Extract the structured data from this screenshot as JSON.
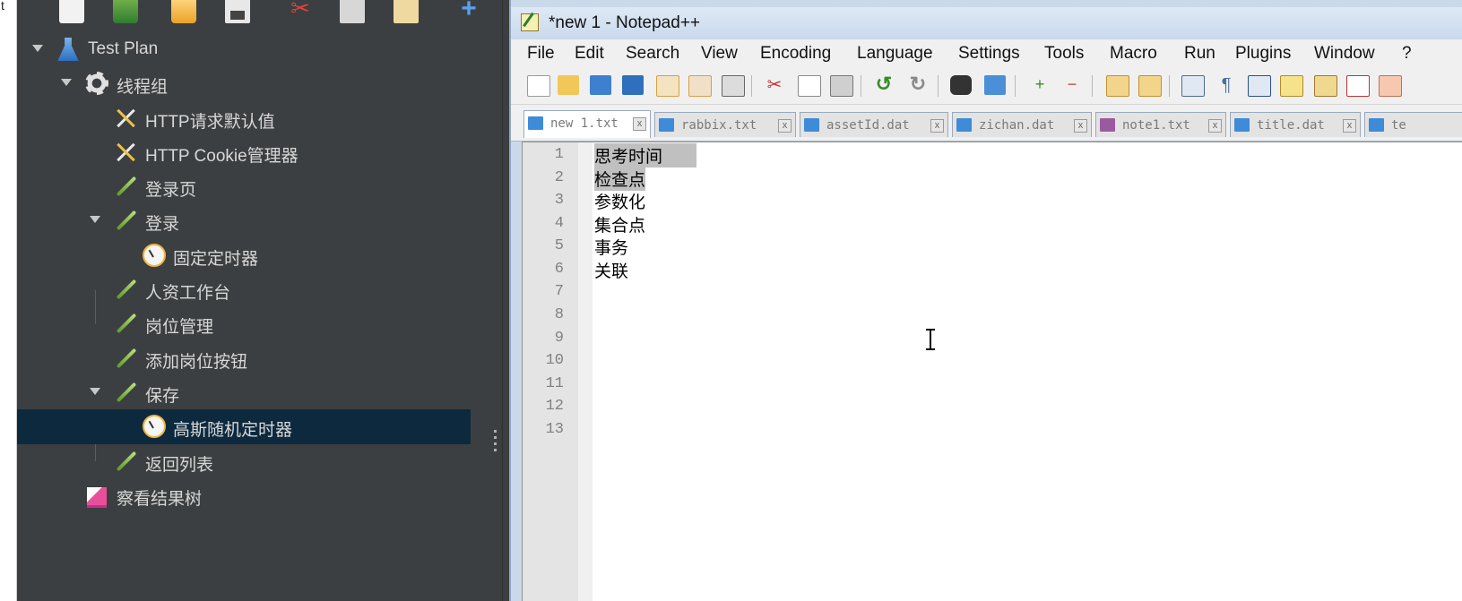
{
  "left_strip": {
    "stray_char": "t"
  },
  "jmeter": {
    "toolbar": [
      "new-icon",
      "templates-icon",
      "open-icon",
      "save-icon",
      "cut-icon",
      "copy-icon",
      "paste-icon",
      "expand-icon",
      "collapse-icon"
    ],
    "tree": [
      {
        "label": "Test Plan",
        "icon": "test-plan-icon",
        "expanded": true
      },
      {
        "label": "线程组",
        "icon": "thread-group-gear-icon",
        "expanded": true
      },
      {
        "label": "HTTP请求默认值",
        "icon": "config-tools-icon"
      },
      {
        "label": "HTTP Cookie管理器",
        "icon": "config-tools-icon"
      },
      {
        "label": "登录页",
        "icon": "sampler-pipette-icon"
      },
      {
        "label": "登录",
        "icon": "sampler-pipette-icon",
        "expanded": true
      },
      {
        "label": "固定定时器",
        "icon": "timer-icon"
      },
      {
        "label": "人资工作台",
        "icon": "sampler-pipette-icon"
      },
      {
        "label": "岗位管理",
        "icon": "sampler-pipette-icon"
      },
      {
        "label": "添加岗位按钮",
        "icon": "sampler-pipette-icon"
      },
      {
        "label": "保存",
        "icon": "sampler-pipette-icon",
        "expanded": true
      },
      {
        "label": "高斯随机定时器",
        "icon": "timer-icon",
        "selected": true
      },
      {
        "label": "返回列表",
        "icon": "sampler-pipette-icon"
      },
      {
        "label": "察看结果树",
        "icon": "results-tree-icon"
      }
    ]
  },
  "notepad": {
    "title": "*new 1 - Notepad++",
    "menu": [
      "File",
      "Edit",
      "Search",
      "View",
      "Encoding",
      "Language",
      "Settings",
      "Tools",
      "Macro",
      "Run",
      "Plugins",
      "Window",
      "?"
    ],
    "tabs": [
      {
        "label": "new 1.txt",
        "active": true
      },
      {
        "label": "rabbix.txt"
      },
      {
        "label": "assetId.dat"
      },
      {
        "label": "zichan.dat"
      },
      {
        "label": "note1.txt"
      },
      {
        "label": "title.dat"
      },
      {
        "label": "te"
      }
    ],
    "lines": [
      "思考时间",
      "检查点",
      "参数化",
      "集合点",
      "事务",
      "关联",
      "",
      "",
      "",
      "",
      "",
      "",
      ""
    ],
    "line_numbers": [
      "1",
      "2",
      "3",
      "4",
      "5",
      "6",
      "7",
      "8",
      "9",
      "10",
      "11",
      "12",
      "13"
    ],
    "selection_color": "#c0c0c0"
  }
}
